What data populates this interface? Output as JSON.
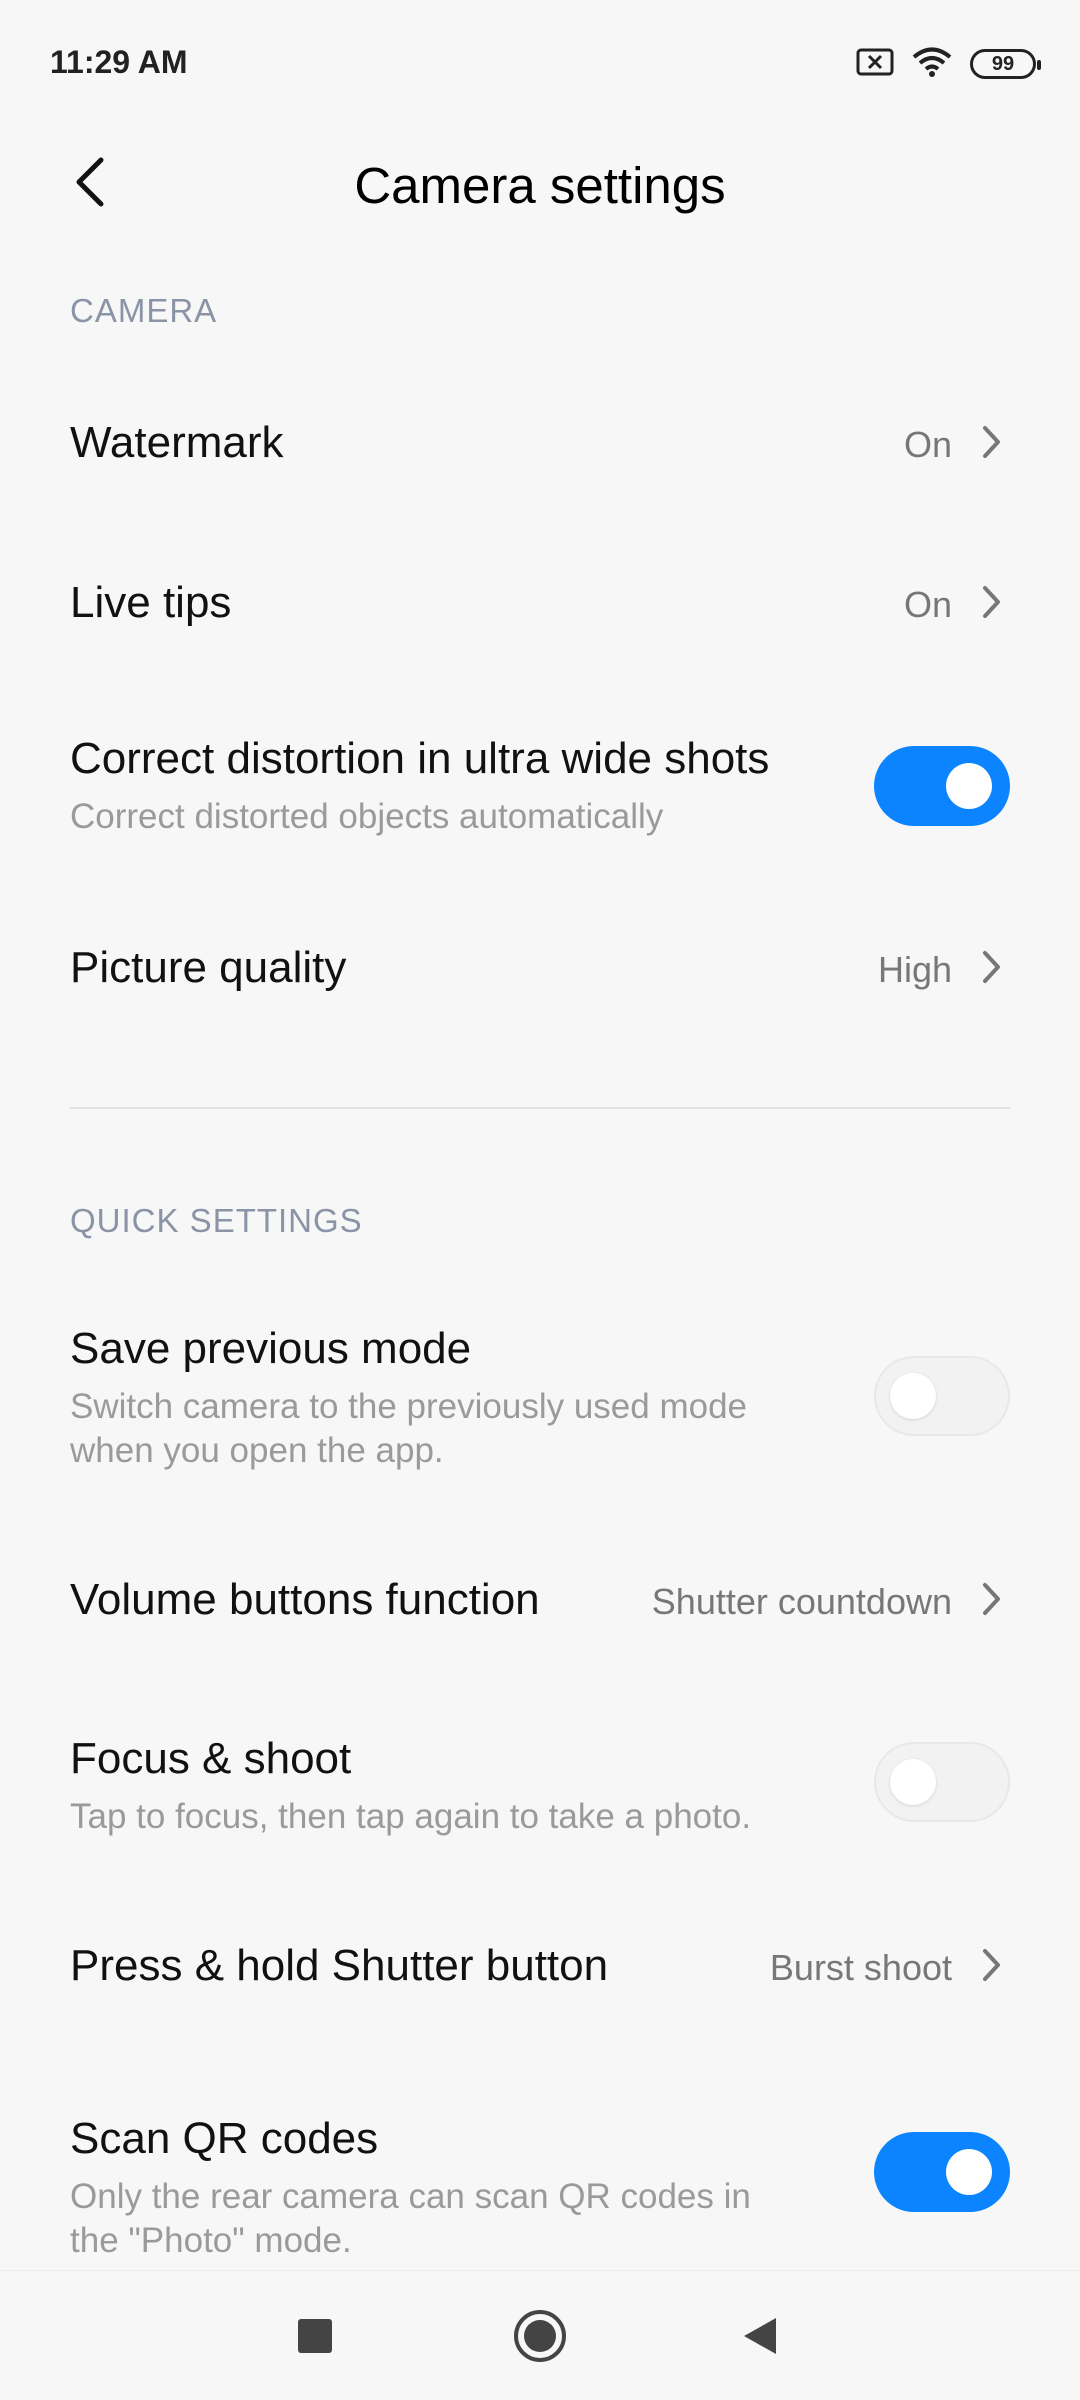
{
  "status_bar": {
    "time": "11:29 AM",
    "battery": "99",
    "icons": [
      "sim-error-icon",
      "wifi-icon",
      "battery-icon"
    ]
  },
  "header": {
    "title": "Camera settings",
    "back_icon": "back-arrow-icon"
  },
  "sections": {
    "camera": "CAMERA",
    "quick_settings": "QUICK SETTINGS"
  },
  "settings": {
    "watermark": {
      "title": "Watermark",
      "value": "On"
    },
    "live_tips": {
      "title": "Live tips",
      "value": "On"
    },
    "correct_distortion": {
      "title": "Correct distortion in ultra wide shots",
      "subtitle": "Correct distorted objects automatically",
      "enabled": true
    },
    "picture_quality": {
      "title": "Picture quality",
      "value": "High"
    },
    "save_previous_mode": {
      "title": "Save previous mode",
      "subtitle_line1": "Switch camera to the previously used mode",
      "subtitle_line2": "when you open the app.",
      "enabled": false
    },
    "volume_buttons": {
      "title": "Volume buttons function",
      "value": "Shutter countdown"
    },
    "focus_shoot": {
      "title": "Focus & shoot",
      "subtitle": "Tap to focus, then tap again to take a photo.",
      "enabled": false
    },
    "press_hold": {
      "title": "Press & hold Shutter button",
      "value": "Burst shoot"
    },
    "scan_qr": {
      "title": "Scan QR codes",
      "subtitle_line1": "Only the rear camera can scan QR codes in",
      "subtitle_line2": "the \"Photo\" mode.",
      "enabled": true
    }
  },
  "colors": {
    "toggle_on": "#0d84ff",
    "section_header": "#8a94a6"
  },
  "nav_bar": {
    "icons": [
      "recents-square-icon",
      "home-circle-icon",
      "back-triangle-icon"
    ]
  }
}
